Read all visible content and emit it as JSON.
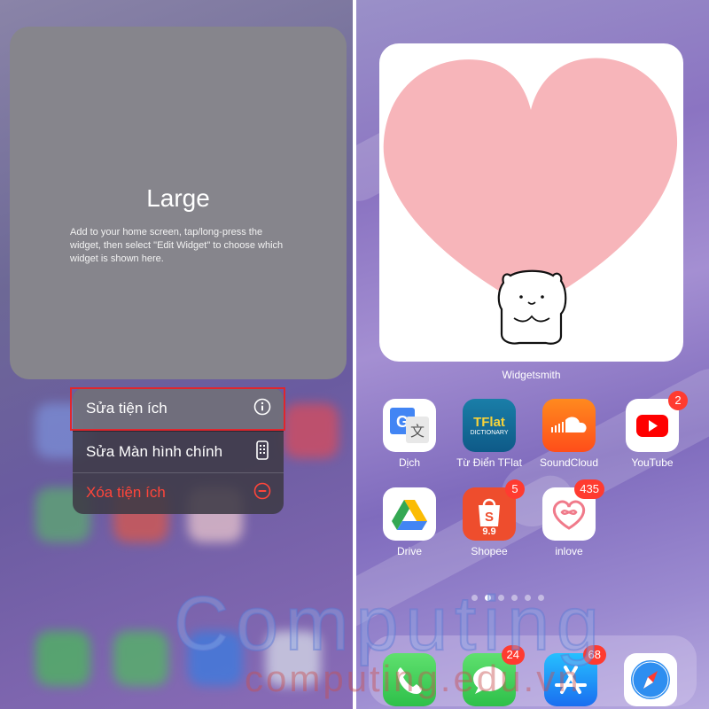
{
  "left_panel": {
    "widget": {
      "title": "Large",
      "description": "Add to your home screen, tap/long-press the widget, then select \"Edit Widget\" to choose which widget is shown here."
    },
    "context_menu": {
      "items": [
        {
          "label": "Sửa tiện ích",
          "icon": "info-circle-icon"
        },
        {
          "label": "Sửa Màn hình chính",
          "icon": "phone-screen-icon"
        },
        {
          "label": "Xóa tiện ích",
          "icon": "minus-circle-icon"
        }
      ]
    }
  },
  "right_panel": {
    "widget": {
      "label": "Widgetsmith",
      "image": "heart-with-bear"
    },
    "apps": [
      {
        "name": "Dịch",
        "icon": "google-translate-icon"
      },
      {
        "name": "Từ Điển TFlat",
        "icon": "tflat-dictionary-icon",
        "icon_text": "TFlat",
        "icon_subtext": "DICTIONARY"
      },
      {
        "name": "SoundCloud",
        "icon": "soundcloud-icon"
      },
      {
        "name": "YouTube",
        "icon": "youtube-icon",
        "badge": "2"
      },
      {
        "name": "Drive",
        "icon": "google-drive-icon"
      },
      {
        "name": "Shopee",
        "icon": "shopee-icon",
        "badge": "5",
        "icon_text": "9.9"
      },
      {
        "name": "inlove",
        "icon": "inlove-icon",
        "badge": "435"
      }
    ],
    "dock": [
      {
        "name": "Phone",
        "icon": "phone-icon"
      },
      {
        "name": "Messages",
        "icon": "messages-icon",
        "badge": "24"
      },
      {
        "name": "App Store",
        "icon": "app-store-icon",
        "badge": "68"
      },
      {
        "name": "Safari",
        "icon": "safari-icon"
      }
    ],
    "page_indicator": {
      "count": 6,
      "active": 1
    }
  },
  "watermark": {
    "main": "Computing",
    "sub": "computing.edu.vn"
  },
  "colors": {
    "destructive": "#ff453a",
    "highlight": "#e0262d",
    "badge": "#ff3b30"
  }
}
